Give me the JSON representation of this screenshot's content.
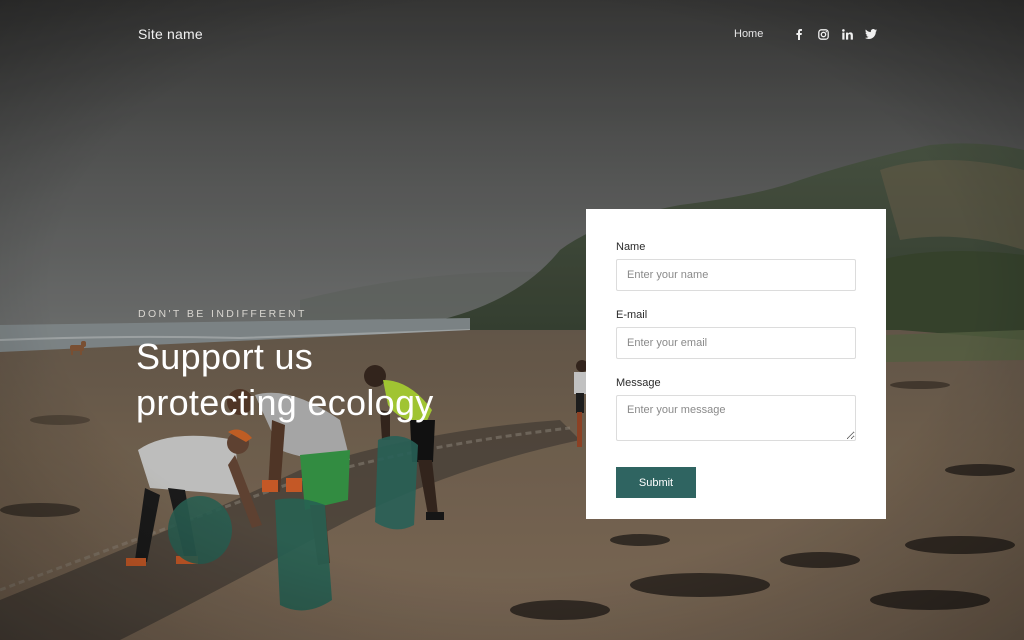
{
  "header": {
    "site_name": "Site name",
    "nav": [
      {
        "label": "Home"
      }
    ],
    "social": [
      {
        "icon": "facebook-icon"
      },
      {
        "icon": "instagram-icon"
      },
      {
        "icon": "linkedin-icon"
      },
      {
        "icon": "twitter-icon"
      }
    ]
  },
  "hero": {
    "eyebrow": "DON'T BE INDIFFERENT",
    "title_line1": "Support us",
    "title_line2": "protecting ecology"
  },
  "form": {
    "name_label": "Name",
    "name_placeholder": "Enter your name",
    "email_label": "E-mail",
    "email_placeholder": "Enter your email",
    "message_label": "Message",
    "message_placeholder": "Enter your message",
    "submit_label": "Submit"
  },
  "colors": {
    "accent": "#2f6461",
    "card_background": "#ffffff",
    "text_light": "#ffffff"
  }
}
